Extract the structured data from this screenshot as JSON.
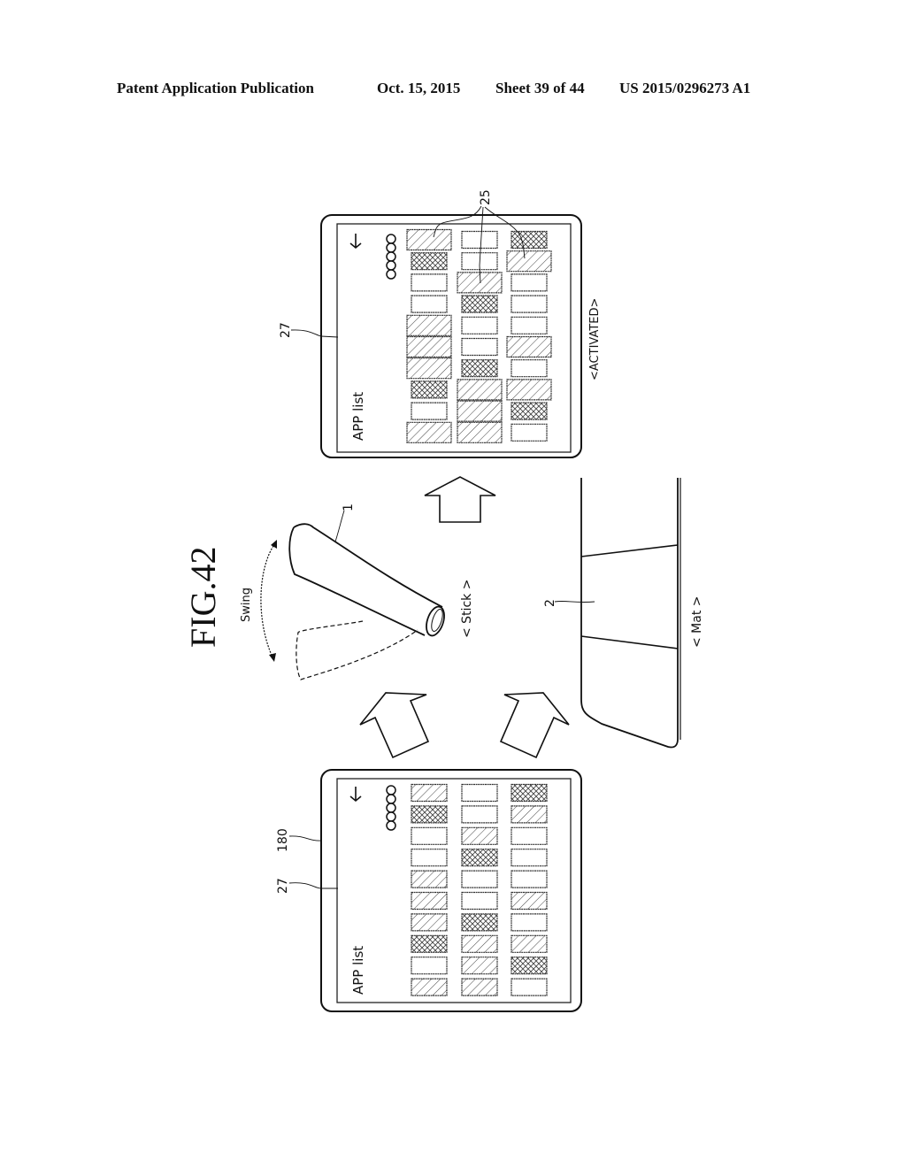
{
  "header": {
    "publication": "Patent Application Publication",
    "date": "Oct. 15, 2015",
    "sheet": "Sheet 39 of 44",
    "number": "US 2015/0296273 A1"
  },
  "figure": {
    "title": "FIG.42",
    "stick_label": "< Stick >",
    "mat_label": "< Mat >",
    "swing_label": "Swing",
    "activated_label": "<ACTIVATED>",
    "ref_stick": "1",
    "ref_mat": "2",
    "ref_tiles": "25",
    "ref_screen_top": "27",
    "ref_screen_bottom": "27",
    "ref_device": "180"
  },
  "panels": {
    "top": {
      "title": "APP list",
      "back_icon": "arrow-left-icon",
      "dots_count": 5,
      "state": "activated",
      "columns": [
        [
          "hatch-wide",
          "cross",
          "plain",
          "plain",
          "hatch-wide",
          "hatch-wide",
          "hatch-wide",
          "cross",
          "plain",
          "hatch-wide"
        ],
        [
          "plain",
          "plain",
          "hatch-wide",
          "cross",
          "plain",
          "plain",
          "cross",
          "hatch-wide",
          "hatch-wide",
          "hatch-wide"
        ],
        [
          "cross",
          "hatch-wide",
          "plain",
          "plain",
          "plain",
          "hatch-wide",
          "plain",
          "hatch-wide",
          "cross",
          "plain"
        ]
      ]
    },
    "bottom": {
      "title": "APP list",
      "back_icon": "arrow-left-icon",
      "dots_count": 5,
      "state": "inactive",
      "columns": [
        [
          "hatch",
          "cross",
          "plain",
          "plain",
          "hatch",
          "hatch",
          "hatch",
          "cross",
          "plain",
          "hatch"
        ],
        [
          "plain",
          "plain",
          "hatch",
          "cross",
          "plain",
          "plain",
          "cross",
          "hatch",
          "hatch",
          "hatch"
        ],
        [
          "cross",
          "hatch",
          "plain",
          "plain",
          "plain",
          "hatch",
          "plain",
          "hatch",
          "cross",
          "plain"
        ]
      ]
    }
  }
}
